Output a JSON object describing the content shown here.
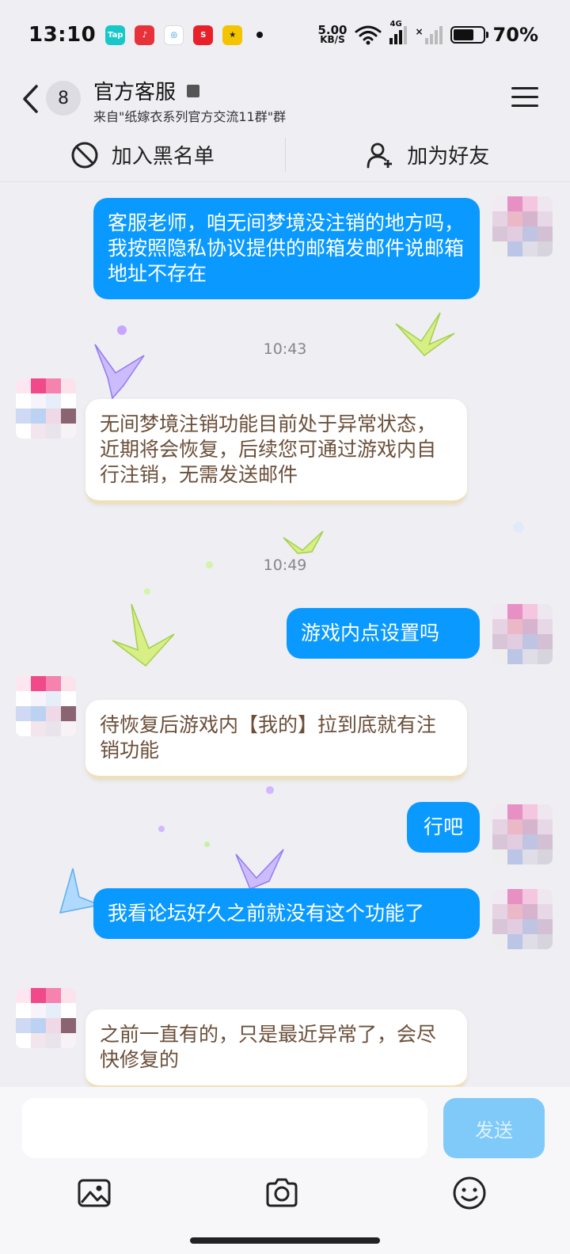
{
  "status_bar": {
    "time": "13:10",
    "net_speed_value": "5.00",
    "net_speed_unit": "KB/S",
    "network_type": "4G",
    "battery_percent": "70%",
    "app_icons": [
      "Tap",
      "music-app-icon",
      "mobile-carrier-icon",
      "S",
      "game-app-icon"
    ]
  },
  "header": {
    "unread_count": "8",
    "title": "官方客服",
    "subtitle": "来自\"纸嫁衣系列官方交流11群\"群"
  },
  "actions": {
    "block_label": "加入黑名单",
    "add_friend_label": "加为好友"
  },
  "messages": [
    {
      "direction": "out",
      "text": "客服老师，咱无间梦境没注销的地方吗，我按照隐私协议提供的邮箱发邮件说邮箱地址不存在"
    },
    {
      "type": "time",
      "text": "10:43"
    },
    {
      "direction": "in",
      "text": "无间梦境注销功能目前处于异常状态，近期将会恢复，后续您可通过游戏内自行注销，无需发送邮件"
    },
    {
      "type": "time",
      "text": "10:49"
    },
    {
      "direction": "out",
      "text": "游戏内点设置吗"
    },
    {
      "direction": "in",
      "text": "待恢复后游戏内【我的】拉到底就有注销功能"
    },
    {
      "direction": "out",
      "text": "行吧"
    },
    {
      "direction": "out",
      "text": "我看论坛好久之前就没有这个功能了"
    },
    {
      "direction": "in",
      "text": "之前一直有的，只是最近异常了，会尽快修复的"
    }
  ],
  "input": {
    "value": "",
    "send_label": "发送"
  },
  "colors": {
    "outgoing_bubble": "#0a99ff",
    "incoming_text": "#6b4f3a",
    "send_button_disabled": "#7fcaf9",
    "background": "#eeeef3"
  }
}
